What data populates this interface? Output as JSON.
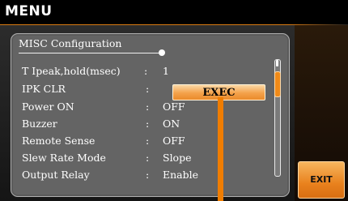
{
  "header": {
    "title": "MENU"
  },
  "panel": {
    "title": "MISC Configuration",
    "rows": [
      {
        "label": "T Ipeak,hold(msec)",
        "colon": ":",
        "value": "1"
      },
      {
        "label": "IPK CLR",
        "colon": ":",
        "value": ""
      },
      {
        "label": "Power ON",
        "colon": ":",
        "value": "OFF"
      },
      {
        "label": "Buzzer",
        "colon": ":",
        "value": "ON"
      },
      {
        "label": "Remote Sense",
        "colon": ":",
        "value": "OFF"
      },
      {
        "label": "Slew Rate Mode",
        "colon": ":",
        "value": "Slope"
      },
      {
        "label": "Output Relay",
        "colon": ":",
        "value": "Enable"
      }
    ],
    "exec_label": "EXEC"
  },
  "softkeys": {
    "exit_label": "EXIT"
  },
  "colors": {
    "accent": "#f07d00",
    "panel": "#646464",
    "background": "#000000"
  }
}
